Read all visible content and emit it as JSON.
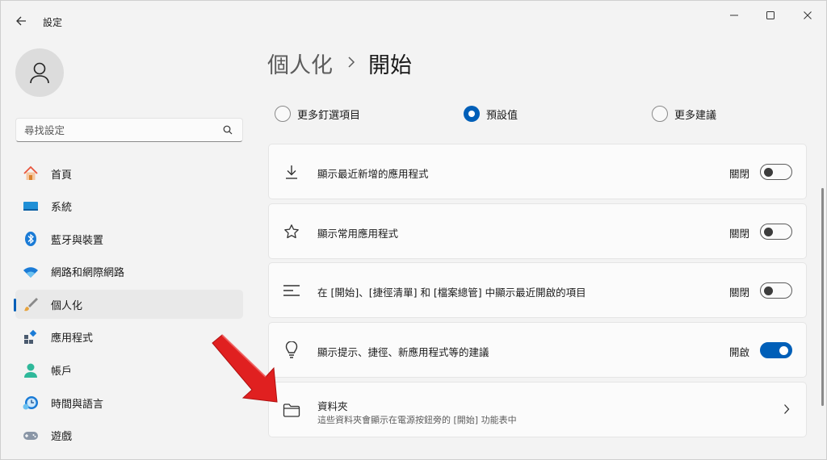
{
  "window": {
    "title": "設定",
    "controls": [
      "minimize-icon",
      "maximize-icon",
      "close-icon"
    ]
  },
  "sidebar": {
    "search_placeholder": "尋找設定",
    "items": [
      {
        "label": "首頁",
        "icon": "home-icon",
        "active": false
      },
      {
        "label": "系統",
        "icon": "system-icon",
        "active": false
      },
      {
        "label": "藍牙與裝置",
        "icon": "bluetooth-icon",
        "active": false
      },
      {
        "label": "網路和網際網路",
        "icon": "network-icon",
        "active": false
      },
      {
        "label": "個人化",
        "icon": "personalization-brush-icon",
        "active": true
      },
      {
        "label": "應用程式",
        "icon": "apps-icon",
        "active": false
      },
      {
        "label": "帳戶",
        "icon": "account-icon",
        "active": false
      },
      {
        "label": "時間與語言",
        "icon": "time-language-icon",
        "active": false
      },
      {
        "label": "遊戲",
        "icon": "gaming-controller-icon",
        "active": false
      }
    ]
  },
  "main": {
    "breadcrumb": {
      "parent": "個人化",
      "current": "開始"
    },
    "layout_options": [
      {
        "label": "更多釘選項目",
        "checked": false
      },
      {
        "label": "預設值",
        "checked": true
      },
      {
        "label": "更多建議",
        "checked": false
      }
    ],
    "settings": [
      {
        "label": "顯示最近新增的應用程式",
        "state": "關閉",
        "on": false,
        "icon": "download-icon"
      },
      {
        "label": "顯示常用應用程式",
        "state": "關閉",
        "on": false,
        "icon": "star-icon"
      },
      {
        "label": "在 [開始]、[捷徑清單] 和 [檔案總管] 中顯示最近開啟的項目",
        "state": "關閉",
        "on": false,
        "icon": "list-icon"
      },
      {
        "label": "顯示提示、捷徑、新應用程式等的建議",
        "state": "開啟",
        "on": true,
        "icon": "lightbulb-icon"
      }
    ],
    "folders": {
      "title": "資料夾",
      "subtitle": "這些資料夾會顯示在電源按鈕旁的 [開始] 功能表中",
      "icon": "folder-icon"
    }
  },
  "colors": {
    "accent": "#005fb8",
    "background": "#f3f3f3",
    "card": "#fbfbfb",
    "annotation_arrow": "#e02020"
  }
}
